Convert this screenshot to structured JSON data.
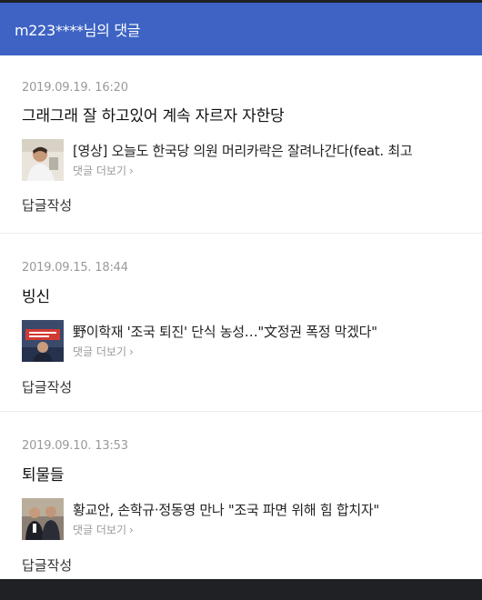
{
  "header": {
    "title": "m223****님의 댓글"
  },
  "comments": [
    {
      "date": "2019.09.19. 16:20",
      "text": "그래그래 잘 하고있어 계속 자르자 자한당",
      "article_title": "[영상] 오늘도 한국당 의원 머리카락은 잘려나간다(feat. 최고",
      "more_label": "댓글 더보기",
      "reply_label": "답글작성"
    },
    {
      "date": "2019.09.15. 18:44",
      "text": "빙신",
      "article_title": "野이학재 '조국 퇴진' 단식 농성…\"文정권 폭정 막겠다\"",
      "more_label": "댓글 더보기",
      "reply_label": "답글작성"
    },
    {
      "date": "2019.09.10. 13:53",
      "text": "퇴물들",
      "article_title": "황교안, 손학규·정동영 만나 \"조국 파면 위해 힘 합치자\"",
      "more_label": "댓글 더보기",
      "reply_label": "답글작성"
    }
  ],
  "icons": {
    "chevron": "chevron-right-icon"
  },
  "colors": {
    "header_bg": "#3e63c4",
    "date": "#9a9a9a"
  }
}
